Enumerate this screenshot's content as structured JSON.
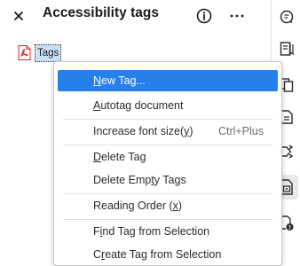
{
  "panel": {
    "title": "Accessibility tags",
    "close_icon": "close-icon",
    "info_icon": "info-icon",
    "more_icon": "more-options-icon"
  },
  "tree": {
    "root_icon": "pdf-file-icon",
    "root_label": "Tags"
  },
  "menu": {
    "items": [
      {
        "pre": "",
        "u": "N",
        "post": "ew Tag...",
        "shortcut": "",
        "highlighted": true
      },
      {
        "pre": "",
        "u": "A",
        "post": "utotag document",
        "shortcut": ""
      },
      {
        "pre": "Increase font size(",
        "u": "y",
        "post": ")",
        "shortcut": "Ctrl+Plus"
      },
      {
        "pre": "",
        "u": "D",
        "post": "elete Tag",
        "shortcut": ""
      },
      {
        "pre": "Delete Emp",
        "u": "t",
        "post": "y Tags",
        "shortcut": ""
      },
      {
        "pre": "Reading Order (",
        "u": "x",
        "post": ")",
        "shortcut": ""
      },
      {
        "pre": "F",
        "u": "i",
        "post": "nd Tag from Selection",
        "shortcut": ""
      },
      {
        "pre": "C",
        "u": "r",
        "post": "eate Tag from Selection",
        "shortcut": ""
      }
    ]
  },
  "sidebar": {
    "icons": [
      "comment-icon",
      "bookmarks-icon",
      "pages-icon",
      "document-properties-icon",
      "order-icon",
      "accessibility-tags-icon",
      "content-icon"
    ]
  },
  "colors": {
    "highlight": "#2680eb",
    "selection": "#c9e0f7",
    "pdf_red": "#e1251b"
  }
}
